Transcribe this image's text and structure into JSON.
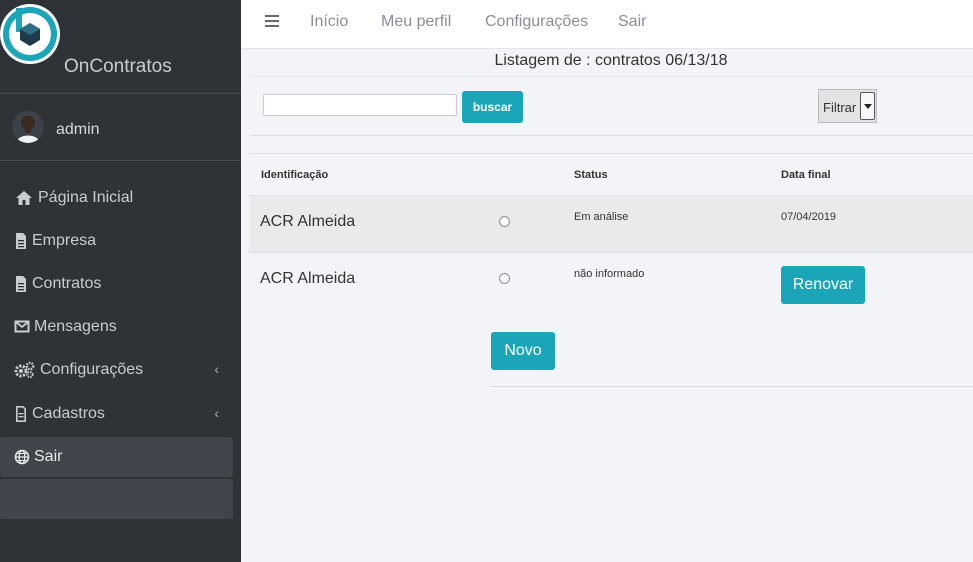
{
  "brand": {
    "name": "OnContratos",
    "logo_icon": "hexagon-b-logo-icon",
    "accent": "#1aa5b8"
  },
  "user": {
    "name": "admin"
  },
  "sidebar": {
    "items": [
      {
        "label": "Página Inicial",
        "icon": "home-icon"
      },
      {
        "label": "Empresa",
        "icon": "file-icon"
      },
      {
        "label": "Contratos",
        "icon": "file-icon"
      },
      {
        "label": "Mensagens",
        "icon": "envelope-icon"
      },
      {
        "label": "Configurações",
        "icon": "gears-icon",
        "chevron": "‹"
      },
      {
        "label": "Cadastros",
        "icon": "file-outline-icon",
        "chevron": "‹"
      },
      {
        "label": "Sair",
        "icon": "globe-icon",
        "active": true
      }
    ]
  },
  "topbar": {
    "links": [
      "Início",
      "Meu perfil",
      "Configurações",
      "Sair"
    ]
  },
  "page": {
    "title": "Listagem de : contratos 06/13/18"
  },
  "search": {
    "placeholder": "",
    "button": "buscar"
  },
  "filter": {
    "label": "Filtrar"
  },
  "table": {
    "headers": {
      "id": "Identificação",
      "status": "Status",
      "end_date": "Data final"
    },
    "rows": [
      {
        "id": "ACR Almeida",
        "status": "Em análise",
        "end_date": "07/04/2019"
      },
      {
        "id": "ACR Almeida",
        "status": "não informado",
        "action": "Renovar"
      }
    ]
  },
  "actions": {
    "new": "Novo"
  }
}
